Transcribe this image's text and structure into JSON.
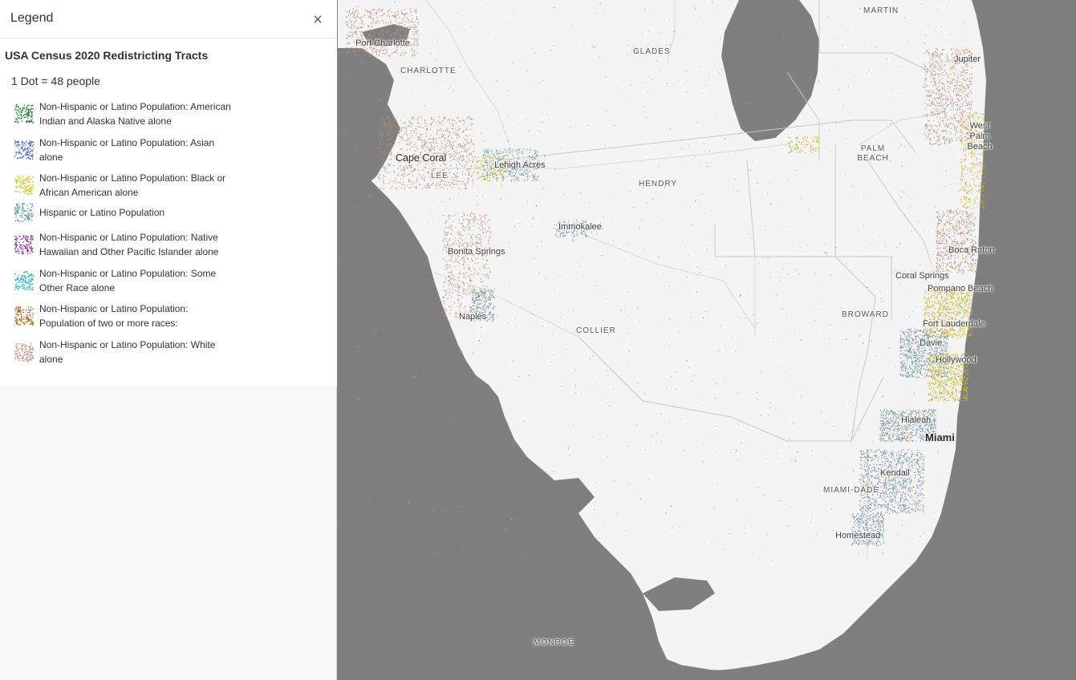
{
  "legend": {
    "title": "Legend",
    "close_label": "×",
    "layer_title": "USA Census 2020 Redistricting Tracts",
    "dot_value": "1 Dot = 48 people",
    "items": [
      {
        "label": "Non-Hispanic or Latino Population: American Indian and Alaska Native alone",
        "color": "#1f7a3a"
      },
      {
        "label": "Non-Hispanic or Latino Population: Asian alone",
        "color": "#4466cc"
      },
      {
        "label": "Non-Hispanic or Latino Population: Black or African American alone",
        "color": "#d4c21c"
      },
      {
        "label": "Hispanic or Latino Population",
        "color": "#6b99a4"
      },
      {
        "label": "Non-Hispanic or Latino Population: Native Hawaiian and Other Pacific Islander alone",
        "color": "#8a2aa8"
      },
      {
        "label": "Non-Hispanic or Latino Population: Some Other Race alone",
        "color": "#1fb5cc"
      },
      {
        "label": "Non-Hispanic or Latino Population: Population of two or more races:",
        "color": "#b06010"
      },
      {
        "label": "Non-Hispanic or Latino Population: White alone",
        "color": "#b89280"
      }
    ]
  },
  "map": {
    "colors": {
      "land": "#f4f4f4",
      "water": "#7f7f7f",
      "roads": "#b8b8b8"
    },
    "county_labels": [
      "MARTIN",
      "GLADES",
      "CHARLOTTE",
      "PALM BEACH",
      "HENDRY",
      "LEE",
      "BROWARD",
      "COLLIER",
      "MIAMI-DADE",
      "MONROE"
    ],
    "city_labels": [
      "Port Charlotte",
      "Jupiter",
      "West Palm Beach",
      "Cape Coral",
      "Lehigh Acres",
      "Immokalee",
      "Bonita Springs",
      "Boca Raton",
      "Coral Springs",
      "Pompano Beach",
      "Naples",
      "Fort Lauderdale",
      "Davie",
      "Hollywood",
      "Hialeah",
      "Miami",
      "Kendall",
      "Homestead"
    ]
  }
}
